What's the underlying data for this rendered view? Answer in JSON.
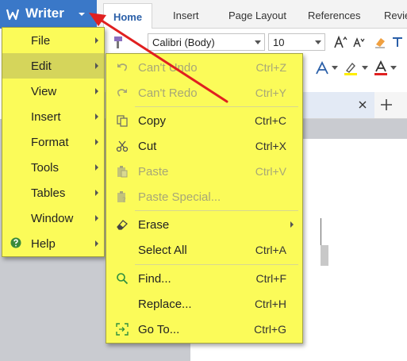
{
  "app": {
    "name": "Writer",
    "accent_color": "#3a78c8",
    "menu_color": "#fbfb59"
  },
  "ribbon": {
    "tabs": [
      "Home",
      "Insert",
      "Page Layout",
      "References",
      "Revie"
    ],
    "font_name": "Calibri (Body)",
    "font_size": "10"
  },
  "main_menu": {
    "items": [
      {
        "label": "File",
        "has_submenu": true
      },
      {
        "label": "Edit",
        "has_submenu": true,
        "active": true
      },
      {
        "label": "View",
        "has_submenu": true
      },
      {
        "label": "Insert",
        "has_submenu": true
      },
      {
        "label": "Format",
        "has_submenu": true
      },
      {
        "label": "Tools",
        "has_submenu": true
      },
      {
        "label": "Tables",
        "has_submenu": true
      },
      {
        "label": "Window",
        "has_submenu": true
      },
      {
        "label": "Help",
        "has_submenu": true,
        "icon": "help-icon"
      }
    ]
  },
  "edit_menu": {
    "items": [
      {
        "label": "Can't Undo",
        "shortcut": "Ctrl+Z",
        "icon": "undo-icon",
        "enabled": false
      },
      {
        "label": "Can't Redo",
        "shortcut": "Ctrl+Y",
        "icon": "redo-icon",
        "enabled": false
      },
      {
        "label": "Copy",
        "shortcut": "Ctrl+C",
        "icon": "copy-icon",
        "enabled": true
      },
      {
        "label": "Cut",
        "shortcut": "Ctrl+X",
        "icon": "scissors-icon",
        "enabled": true
      },
      {
        "label": "Paste",
        "shortcut": "Ctrl+V",
        "icon": "paste-icon",
        "enabled": false
      },
      {
        "label": "Paste Special...",
        "shortcut": "",
        "icon": "paste-special-icon",
        "enabled": false
      },
      {
        "label": "Erase",
        "shortcut": "",
        "icon": "eraser-icon",
        "enabled": true,
        "has_submenu": true
      },
      {
        "label": "Select All",
        "shortcut": "Ctrl+A",
        "enabled": true
      },
      {
        "label": "Find...",
        "shortcut": "Ctrl+F",
        "icon": "search-icon",
        "enabled": true
      },
      {
        "label": "Replace...",
        "shortcut": "Ctrl+H",
        "enabled": true
      },
      {
        "label": "Go To...",
        "shortcut": "Ctrl+G",
        "icon": "goto-icon",
        "enabled": true
      }
    ]
  }
}
